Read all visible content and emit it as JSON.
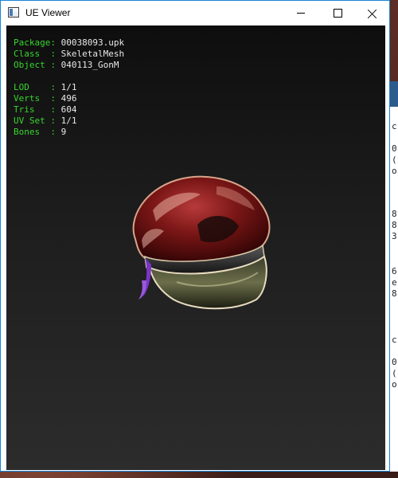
{
  "window": {
    "title": "UE Viewer"
  },
  "titlebar_icons": {
    "app": "app-window-icon",
    "minimize": "minimize-icon",
    "maximize": "maximize-icon",
    "close": "close-icon"
  },
  "info": {
    "package_label": "Package",
    "package_value": "00038093.upk",
    "class_label": "Class  ",
    "class_value": "SkeletalMesh",
    "object_label": "Object ",
    "object_value": "040113_GonM",
    "lod_label": "LOD    ",
    "lod_value": "1/1",
    "verts_label": "Verts  ",
    "verts_value": "496",
    "tris_label": "Tris   ",
    "tris_value": "604",
    "uvset_label": "UV Set ",
    "uvset_value": "1/1",
    "bones_label": "Bones  ",
    "bones_value": "9"
  },
  "colors": {
    "label": "#38d52e",
    "value": "#e8e8e8",
    "window_border": "#1883d7"
  },
  "mesh": {
    "description_icon": "cap-mesh"
  },
  "background_fragments": [
    "c",
    "0",
    "(",
    "o",
    "8",
    "8",
    "3",
    "6",
    "e",
    "8",
    "c",
    "0",
    "(",
    "o"
  ]
}
